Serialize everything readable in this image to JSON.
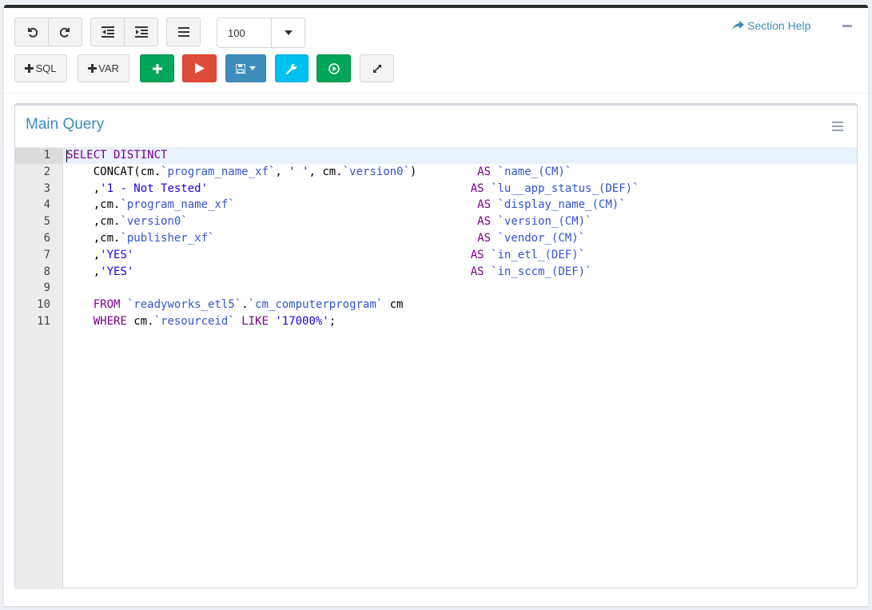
{
  "toolbar": {
    "zoom_value": "100",
    "add_sql_label": "SQL",
    "add_var_label": "VAR",
    "section_help_label": "Section Help"
  },
  "colors": {
    "accent": "#3c8dbc",
    "green": "#00a65a",
    "red": "#dd4b39",
    "aqua": "#00c0ef"
  },
  "icons": [
    "undo-icon",
    "redo-icon",
    "outdent-icon",
    "indent-icon",
    "list-icon",
    "caret-down-icon",
    "plus-icon",
    "play-icon",
    "save-icon",
    "wrench-icon",
    "play-circle-icon",
    "expand-icon",
    "share-icon",
    "minus-icon",
    "menu-icon"
  ],
  "main_query": {
    "title": "Main Query",
    "lines": [
      [
        {
          "t": "SELECT DISTINCT",
          "c": "kw"
        }
      ],
      [
        {
          "t": "    CONCAT(cm.",
          "c": "pl"
        },
        {
          "t": "`program_name_xf`",
          "c": "bt"
        },
        {
          "t": ", ",
          "c": "pl"
        },
        {
          "t": "' '",
          "c": "st"
        },
        {
          "t": ", cm.",
          "c": "pl"
        },
        {
          "t": "`version0`",
          "c": "bt"
        },
        {
          "t": ")         ",
          "c": "pl"
        },
        {
          "t": "AS",
          "c": "kw"
        },
        {
          "t": " ",
          "c": "pl"
        },
        {
          "t": "`name_(CM)`",
          "c": "bt"
        }
      ],
      [
        {
          "t": "    ,",
          "c": "pl"
        },
        {
          "t": "'1 - Not Tested'",
          "c": "st"
        },
        {
          "t": "                                       ",
          "c": "pl"
        },
        {
          "t": "AS",
          "c": "kw"
        },
        {
          "t": " ",
          "c": "pl"
        },
        {
          "t": "`lu__app_status_(DEF)`",
          "c": "bt"
        }
      ],
      [
        {
          "t": "    ,cm.",
          "c": "pl"
        },
        {
          "t": "`program_name_xf`",
          "c": "bt"
        },
        {
          "t": "                                    ",
          "c": "pl"
        },
        {
          "t": "AS",
          "c": "kw"
        },
        {
          "t": " ",
          "c": "pl"
        },
        {
          "t": "`display_name_(CM)`",
          "c": "bt"
        }
      ],
      [
        {
          "t": "    ,cm.",
          "c": "pl"
        },
        {
          "t": "`version0`",
          "c": "bt"
        },
        {
          "t": "                                           ",
          "c": "pl"
        },
        {
          "t": "AS",
          "c": "kw"
        },
        {
          "t": " ",
          "c": "pl"
        },
        {
          "t": "`version_(CM)`",
          "c": "bt"
        }
      ],
      [
        {
          "t": "    ,cm.",
          "c": "pl"
        },
        {
          "t": "`publisher_xf`",
          "c": "bt"
        },
        {
          "t": "                                       ",
          "c": "pl"
        },
        {
          "t": "AS",
          "c": "kw"
        },
        {
          "t": " ",
          "c": "pl"
        },
        {
          "t": "`vendor_(CM)`",
          "c": "bt"
        }
      ],
      [
        {
          "t": "    ,",
          "c": "pl"
        },
        {
          "t": "'YES'",
          "c": "st"
        },
        {
          "t": "                                                  ",
          "c": "pl"
        },
        {
          "t": "AS",
          "c": "kw"
        },
        {
          "t": " ",
          "c": "pl"
        },
        {
          "t": "`in_etl_(DEF)`",
          "c": "bt"
        }
      ],
      [
        {
          "t": "    ,",
          "c": "pl"
        },
        {
          "t": "'YES'",
          "c": "st"
        },
        {
          "t": "                                                  ",
          "c": "pl"
        },
        {
          "t": "AS",
          "c": "kw"
        },
        {
          "t": " ",
          "c": "pl"
        },
        {
          "t": "`in_sccm_(DEF)`",
          "c": "bt"
        }
      ],
      [],
      [
        {
          "t": "    ",
          "c": "pl"
        },
        {
          "t": "FROM",
          "c": "kw"
        },
        {
          "t": " ",
          "c": "pl"
        },
        {
          "t": "`readyworks_etl5`",
          "c": "bt"
        },
        {
          "t": ".",
          "c": "pl"
        },
        {
          "t": "`cm_computerprogram`",
          "c": "bt"
        },
        {
          "t": " cm",
          "c": "pl"
        }
      ],
      [
        {
          "t": "    ",
          "c": "pl"
        },
        {
          "t": "WHERE",
          "c": "kw"
        },
        {
          "t": " cm.",
          "c": "pl"
        },
        {
          "t": "`resourceid`",
          "c": "bt"
        },
        {
          "t": " ",
          "c": "pl"
        },
        {
          "t": "LIKE",
          "c": "kw"
        },
        {
          "t": " ",
          "c": "pl"
        },
        {
          "t": "'17000%'",
          "c": "st"
        },
        {
          "t": ";",
          "c": "pl"
        }
      ]
    ]
  }
}
